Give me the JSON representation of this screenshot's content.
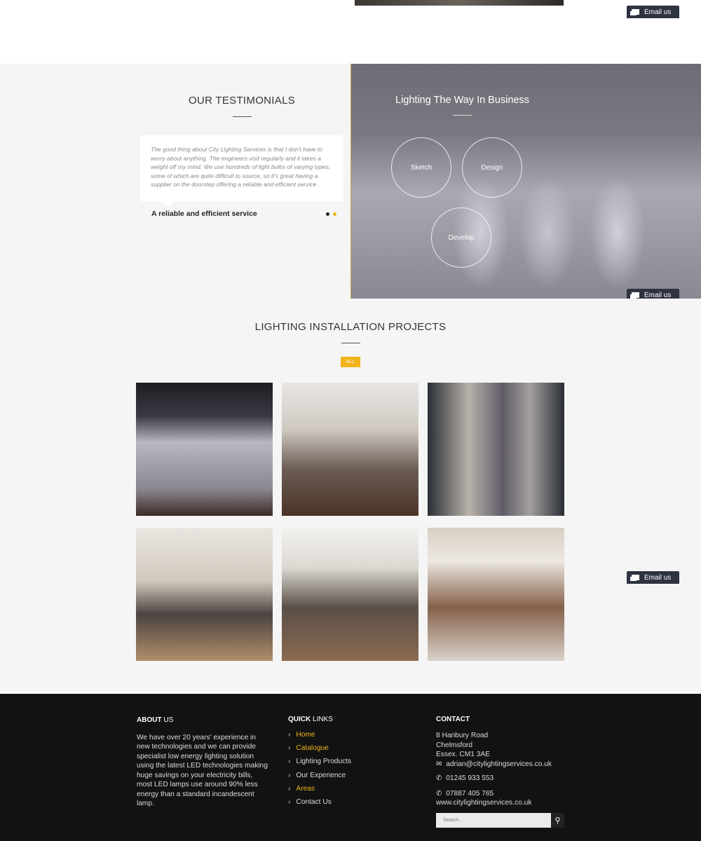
{
  "email_button": {
    "label": "Email us",
    "icon": "chat-icon"
  },
  "testimonials": {
    "heading": "OUR TESTIMONIALS",
    "quote": "The good thing about City Lighting Services is that I don't have to worry about anything. The engineers visit regularly and it takes a weight off my mind. We use hundreds of light bulbs of varying types, some of which are quite difficult to source, so it's great having a supplier on the doorstep offering a reliable and efficient service .",
    "title": "A reliable and efficient service",
    "active_dot": 2,
    "dot_count": 2
  },
  "hero": {
    "heading": "Lighting The Way In Business",
    "circles": [
      "Sketch",
      "Design",
      "Develop"
    ]
  },
  "projects": {
    "heading": "LIGHTING INSTALLATION PROJECTS",
    "filter": "ALL"
  },
  "footer": {
    "about": {
      "title_bold": "ABOUT",
      "title_rest": " US",
      "text": "We have over 20 years' experience in new technologies and we can provide specialist low energy lighting solution using the latest LED technologies making huge savings on your electricity bills, most LED lamps use around 90% less energy than a standard incandescent lamp."
    },
    "links": {
      "title_bold": "QUICK",
      "title_rest": " LINKS",
      "items": [
        "Home",
        "Catalogue",
        "Lighting Products",
        "Our Experience",
        "Areas",
        "Contact Us"
      ]
    },
    "contact": {
      "title": "CONTACT",
      "address": [
        "8 Hanbury Road",
        "Chelmsford",
        "Essex. CM1 3AE"
      ],
      "email": "adrian@citylightingservices.co.uk",
      "phone1": "01245 933 553",
      "phone2": "07887 405 765",
      "website": "www.citylightingservices.co.uk"
    },
    "search": {
      "placeholder": "Search..."
    }
  },
  "colors": {
    "accent": "#f0b41c",
    "footer_bg": "#121212",
    "section_bg": "#f6f5f5",
    "email_bg": "#2e3340"
  }
}
